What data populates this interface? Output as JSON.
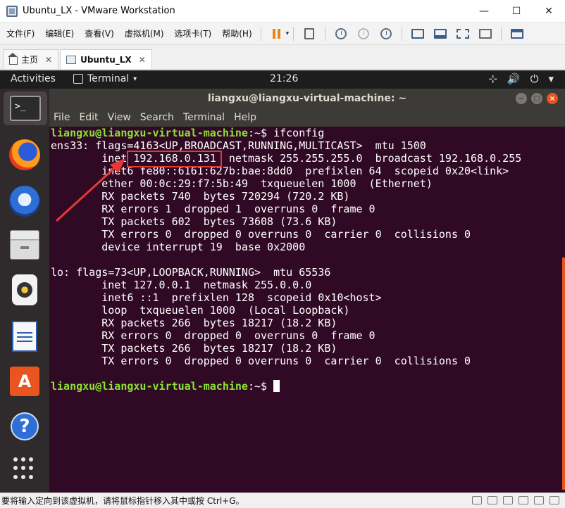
{
  "window": {
    "title": "Ubuntu_LX - VMware Workstation",
    "minimize": "—",
    "maximize": "☐",
    "close": "✕"
  },
  "menubar": {
    "items": [
      "文件(F)",
      "编辑(E)",
      "查看(V)",
      "虚拟机(M)",
      "选项卡(T)",
      "帮助(H)"
    ],
    "dropdown": "▾"
  },
  "tabs": [
    {
      "label": "主页"
    },
    {
      "label": "Ubuntu_LX"
    }
  ],
  "tab_close": "✕",
  "ubuntu": {
    "activities": "Activities",
    "app_menu": "Terminal",
    "app_menu_arrow": "▾",
    "clock": "21:26",
    "network_icon": "⊹",
    "volume_icon": "🔊",
    "power_icon": "⏻",
    "tray_arrow": "▾"
  },
  "dock": {
    "store_glyph": "A",
    "help_glyph": "?",
    "terminal_glyph": ">_"
  },
  "terminal": {
    "title": "liangxu@liangxu-virtual-machine: ~",
    "btn_min": "−",
    "btn_max": "□",
    "btn_close": "×",
    "menu": [
      "File",
      "Edit",
      "View",
      "Search",
      "Terminal",
      "Help"
    ],
    "prompt_user": "liangxu@liangxu-virtual-machine",
    "prompt_path": ":~$ ",
    "command": "ifconfig",
    "lines": [
      "ens33: flags=4163<UP,BROADCAST,RUNNING,MULTICAST>  mtu 1500",
      "        inet 192.168.0.131  netmask 255.255.255.0  broadcast 192.168.0.255",
      "        inet6 fe80::6161:627b:bae:8dd0  prefixlen 64  scopeid 0x20<link>",
      "        ether 00:0c:29:f7:5b:49  txqueuelen 1000  (Ethernet)",
      "        RX packets 740  bytes 720294 (720.2 KB)",
      "        RX errors 1  dropped 1  overruns 0  frame 0",
      "        TX packets 602  bytes 73608 (73.6 KB)",
      "        TX errors 0  dropped 0 overruns 0  carrier 0  collisions 0",
      "        device interrupt 19  base 0x2000",
      "",
      "lo: flags=73<UP,LOOPBACK,RUNNING>  mtu 65536",
      "        inet 127.0.0.1  netmask 255.0.0.0",
      "        inet6 ::1  prefixlen 128  scopeid 0x10<host>",
      "        loop  txqueuelen 1000  (Local Loopback)",
      "        RX packets 266  bytes 18217 (18.2 KB)",
      "        RX errors 0  dropped 0  overruns 0  frame 0",
      "        TX packets 266  bytes 18217 (18.2 KB)",
      "        TX errors 0  dropped 0 overruns 0  carrier 0  collisions 0",
      ""
    ]
  },
  "statusbar": {
    "text": "要将输入定向到该虚拟机，请将鼠标指针移入其中或按 Ctrl+G。"
  },
  "colors": {
    "terminal_bg": "#300a24",
    "prompt_green": "#8ae234",
    "prompt_blue": "#729fcf",
    "highlight_red": "#e53935",
    "ubuntu_orange": "#e95420"
  }
}
